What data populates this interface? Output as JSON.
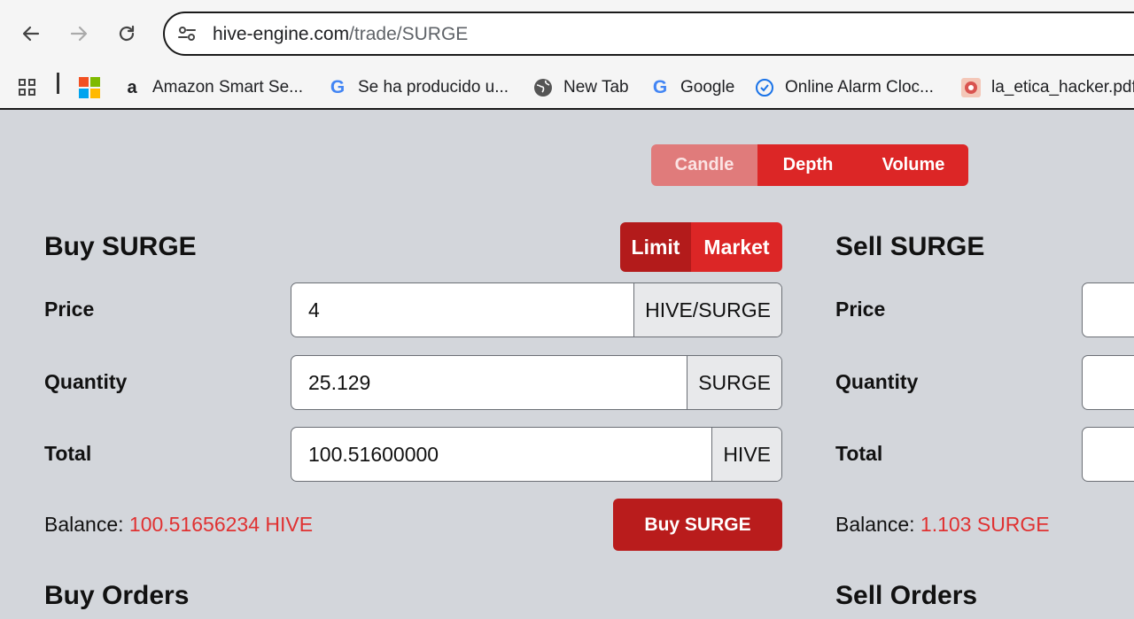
{
  "browser": {
    "url_host": "hive-engine.com",
    "url_path": "/trade/SURGE",
    "bookmarks": [
      {
        "label": "Amazon Smart Se...",
        "icon": "amazon-icon"
      },
      {
        "label": "Se ha producido u...",
        "icon": "google-icon"
      },
      {
        "label": "New Tab",
        "icon": "globe-icon"
      },
      {
        "label": "Google",
        "icon": "google-icon"
      },
      {
        "label": "Online Alarm Cloc...",
        "icon": "alarm-clock-icon"
      },
      {
        "label": "la_etica_hacker.pdf",
        "icon": "pdf-icon"
      }
    ]
  },
  "chart_tabs": {
    "candle": "Candle",
    "depth": "Depth",
    "volume": "Volume"
  },
  "buy": {
    "heading": "Buy SURGE",
    "order_types": {
      "limit": "Limit",
      "market": "Market"
    },
    "price_label": "Price",
    "price_value": "4",
    "price_unit": "HIVE/SURGE",
    "quantity_label": "Quantity",
    "quantity_value": "25.129",
    "quantity_unit": "SURGE",
    "total_label": "Total",
    "total_value": "100.51600000",
    "total_unit": "HIVE",
    "balance_label": "Balance:",
    "balance_value": "100.51656234 HIVE",
    "button": "Buy SURGE",
    "orders_heading": "Buy Orders"
  },
  "sell": {
    "heading": "Sell SURGE",
    "price_label": "Price",
    "quantity_label": "Quantity",
    "total_label": "Total",
    "balance_label": "Balance:",
    "balance_value": "1.103 SURGE",
    "orders_heading": "Sell Orders"
  },
  "colors": {
    "accent": "#dc2626",
    "accent_dark": "#b91c1c",
    "balance": "#e03131",
    "page_bg": "#d3d6db"
  }
}
